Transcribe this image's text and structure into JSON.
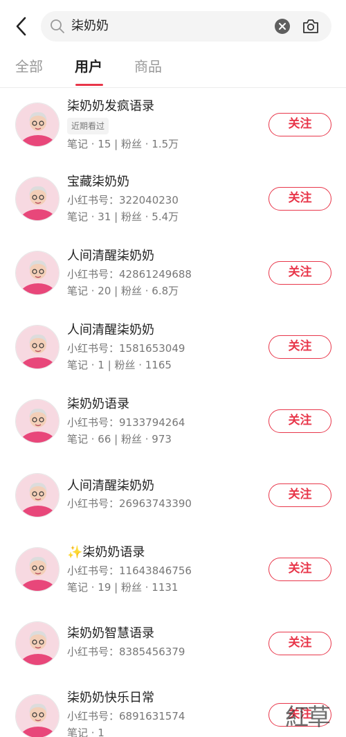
{
  "search": {
    "query": "柒奶奶"
  },
  "tabs": [
    {
      "label": "全部",
      "active": false
    },
    {
      "label": "用户",
      "active": true
    },
    {
      "label": "商品",
      "active": false
    }
  ],
  "colors": {
    "accent": "#e8364a",
    "avatar_shirt": "#e8477a",
    "avatar_bg": "#f7d9e1"
  },
  "users": [
    {
      "name": "柒奶奶发疯语录",
      "badge": "近期看过",
      "redbook_id": "",
      "stats": "笔记 · 15 | 粉丝 · 1.5万",
      "follow_label": "关注"
    },
    {
      "name": "宝藏柒奶奶",
      "badge": "",
      "redbook_id": "小红书号：322040230",
      "stats": "笔记 · 31 | 粉丝 · 5.4万",
      "follow_label": "关注"
    },
    {
      "name": "人间清醒柒奶奶",
      "badge": "",
      "redbook_id": "小红书号：42861249688",
      "stats": "笔记 · 20 | 粉丝 · 6.8万",
      "follow_label": "关注"
    },
    {
      "name": "人间清醒柒奶奶",
      "badge": "",
      "redbook_id": "小红书号：1581653049",
      "stats": "笔记 · 1 | 粉丝 · 1165",
      "follow_label": "关注"
    },
    {
      "name": "柒奶奶语录",
      "badge": "",
      "redbook_id": "小红书号：9133794264",
      "stats": "笔记 · 66 | 粉丝 · 973",
      "follow_label": "关注"
    },
    {
      "name": "人间清醒柒奶奶",
      "badge": "",
      "redbook_id": "小红书号：26963743390",
      "stats": "",
      "follow_label": "关注"
    },
    {
      "name": "✨柒奶奶语录",
      "badge": "",
      "redbook_id": "小红书号：11643846756",
      "stats": "笔记 · 19 | 粉丝 · 1131",
      "follow_label": "关注"
    },
    {
      "name": "柒奶奶智慧语录",
      "badge": "",
      "redbook_id": "小红书号：8385456379",
      "stats": "",
      "follow_label": "关注"
    },
    {
      "name": "柒奶奶快乐日常",
      "badge": "",
      "redbook_id": "小红书号：6891631574",
      "stats": "笔记 · 1",
      "follow_label": "关注"
    }
  ],
  "watermark": {
    "text": "紅草"
  }
}
